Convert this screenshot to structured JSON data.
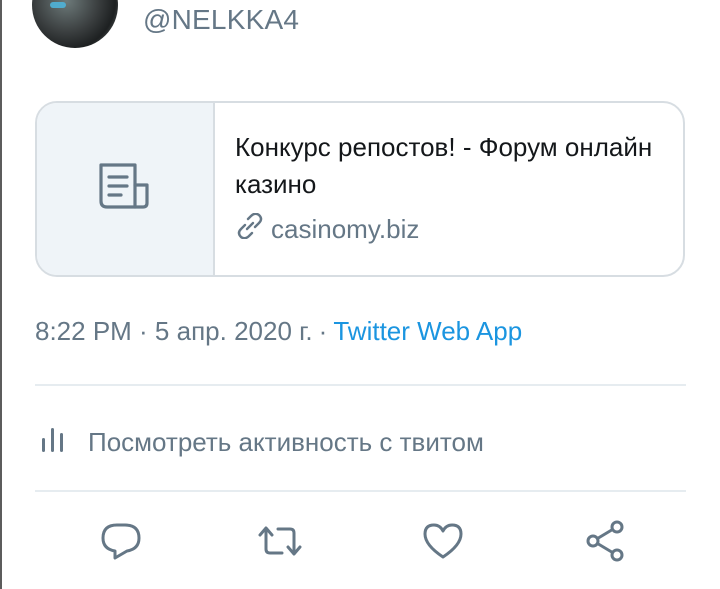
{
  "tweet": {
    "handle": "@NELKKA4",
    "timestamp": "8:22 PM · 5 апр. 2020 г.",
    "separator": "·",
    "source": "Twitter Web App",
    "source_color": "#1b95e0"
  },
  "card": {
    "title": "Конкурс репостов! - Форум онлайн казино",
    "domain": "casinomy.biz",
    "thumb_icon": "document-icon",
    "domain_icon": "link-icon"
  },
  "activity": {
    "label": "Посмотреть активность с твитом",
    "icon": "analytics-icon"
  },
  "actions": {
    "reply_icon": "reply-icon",
    "retweet_icon": "retweet-icon",
    "like_icon": "heart-icon",
    "share_icon": "share-icon"
  },
  "colors": {
    "text_secondary": "#657786",
    "text_primary": "#14171a",
    "border": "#d7dde2"
  }
}
